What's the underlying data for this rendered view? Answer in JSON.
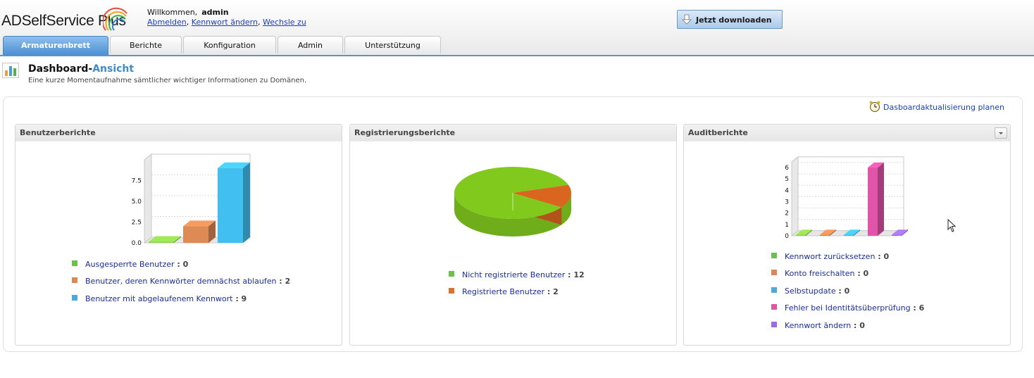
{
  "header": {
    "logo_text": "ADSelfService Plus",
    "welcome_text": "Willkommen,",
    "user_name": "admin",
    "links": {
      "logout": "Abmelden",
      "change_password": "Kennwort ändern",
      "switch_to": "Wechsle zu"
    },
    "download_label": "Jetzt downloaden"
  },
  "tabs": [
    {
      "label": "Armaturenbrett",
      "active": true
    },
    {
      "label": "Berichte",
      "active": false
    },
    {
      "label": "Konfiguration",
      "active": false
    },
    {
      "label": "Admin",
      "active": false
    },
    {
      "label": "Unterstützung",
      "active": false
    }
  ],
  "page": {
    "title_prefix": "Dashboard-",
    "title_accent": "Ansicht",
    "subtitle": "Eine kurze Momentaufnahme sämtlicher wichtiger Informationen zu Domänen.",
    "schedule_link": "Dasboardaktualisierung planen"
  },
  "panels": [
    {
      "title": "Benutzerberichte",
      "legend": [
        {
          "label": "Ausgesperrte Benutzer",
          "value": 0,
          "color": "#6cc14a"
        },
        {
          "label": "Benutzer, deren Kennwörter demnächst ablaufen",
          "value": 2,
          "color": "#d98a54"
        },
        {
          "label": "Benutzer mit abgelaufenem Kennwort",
          "value": 9,
          "color": "#4fa8dc"
        }
      ]
    },
    {
      "title": "Registrierungsberichte",
      "legend": [
        {
          "label": "Nicht registrierte Benutzer",
          "value": 12,
          "color": "#6cc14a"
        },
        {
          "label": "Registrierte Benutzer",
          "value": 2,
          "color": "#d9722e"
        }
      ]
    },
    {
      "title": "Auditberichte",
      "legend": [
        {
          "label": "Kennwort zurücksetzen",
          "value": 0,
          "color": "#6cc14a"
        },
        {
          "label": "Konto freischalten",
          "value": 0,
          "color": "#d98a54"
        },
        {
          "label": "Selbstupdate",
          "value": 0,
          "color": "#4fa8dc"
        },
        {
          "label": "Fehler bei Identitätsüberprüfung",
          "value": 6,
          "color": "#e0559f"
        },
        {
          "label": "Kennwort ändern",
          "value": 0,
          "color": "#9b6ee0"
        }
      ]
    }
  ],
  "chart_data": [
    {
      "type": "bar",
      "categories": [
        "Ausgesperrte Benutzer",
        "Benutzer, deren Kennwörter demnächst ablaufen",
        "Benutzer mit abgelaufenem Kennwort"
      ],
      "values": [
        0,
        2,
        9
      ],
      "colors": [
        "#8fd14f",
        "#dd8a55",
        "#41bff0"
      ],
      "ylim": [
        0,
        10
      ],
      "yticks": [
        "0.0",
        "2.5",
        "5.0",
        "7.5"
      ]
    },
    {
      "type": "pie",
      "categories": [
        "Nicht registrierte Benutzer",
        "Registrierte Benutzer"
      ],
      "values": [
        12,
        2
      ],
      "colors": [
        "#82c91e",
        "#d9651f"
      ]
    },
    {
      "type": "bar",
      "categories": [
        "Kennwort zurücksetzen",
        "Konto freischalten",
        "Selbstupdate",
        "Fehler bei Identitätsüberprüfung",
        "Kennwort ändern"
      ],
      "values": [
        0,
        0,
        0,
        6,
        0
      ],
      "colors": [
        "#8fd14f",
        "#dd8a55",
        "#41bff0",
        "#e055a8",
        "#a070e8"
      ],
      "ylim": [
        0,
        6.5
      ],
      "yticks": [
        "0",
        "1",
        "2",
        "3",
        "4",
        "5",
        "6"
      ]
    }
  ]
}
